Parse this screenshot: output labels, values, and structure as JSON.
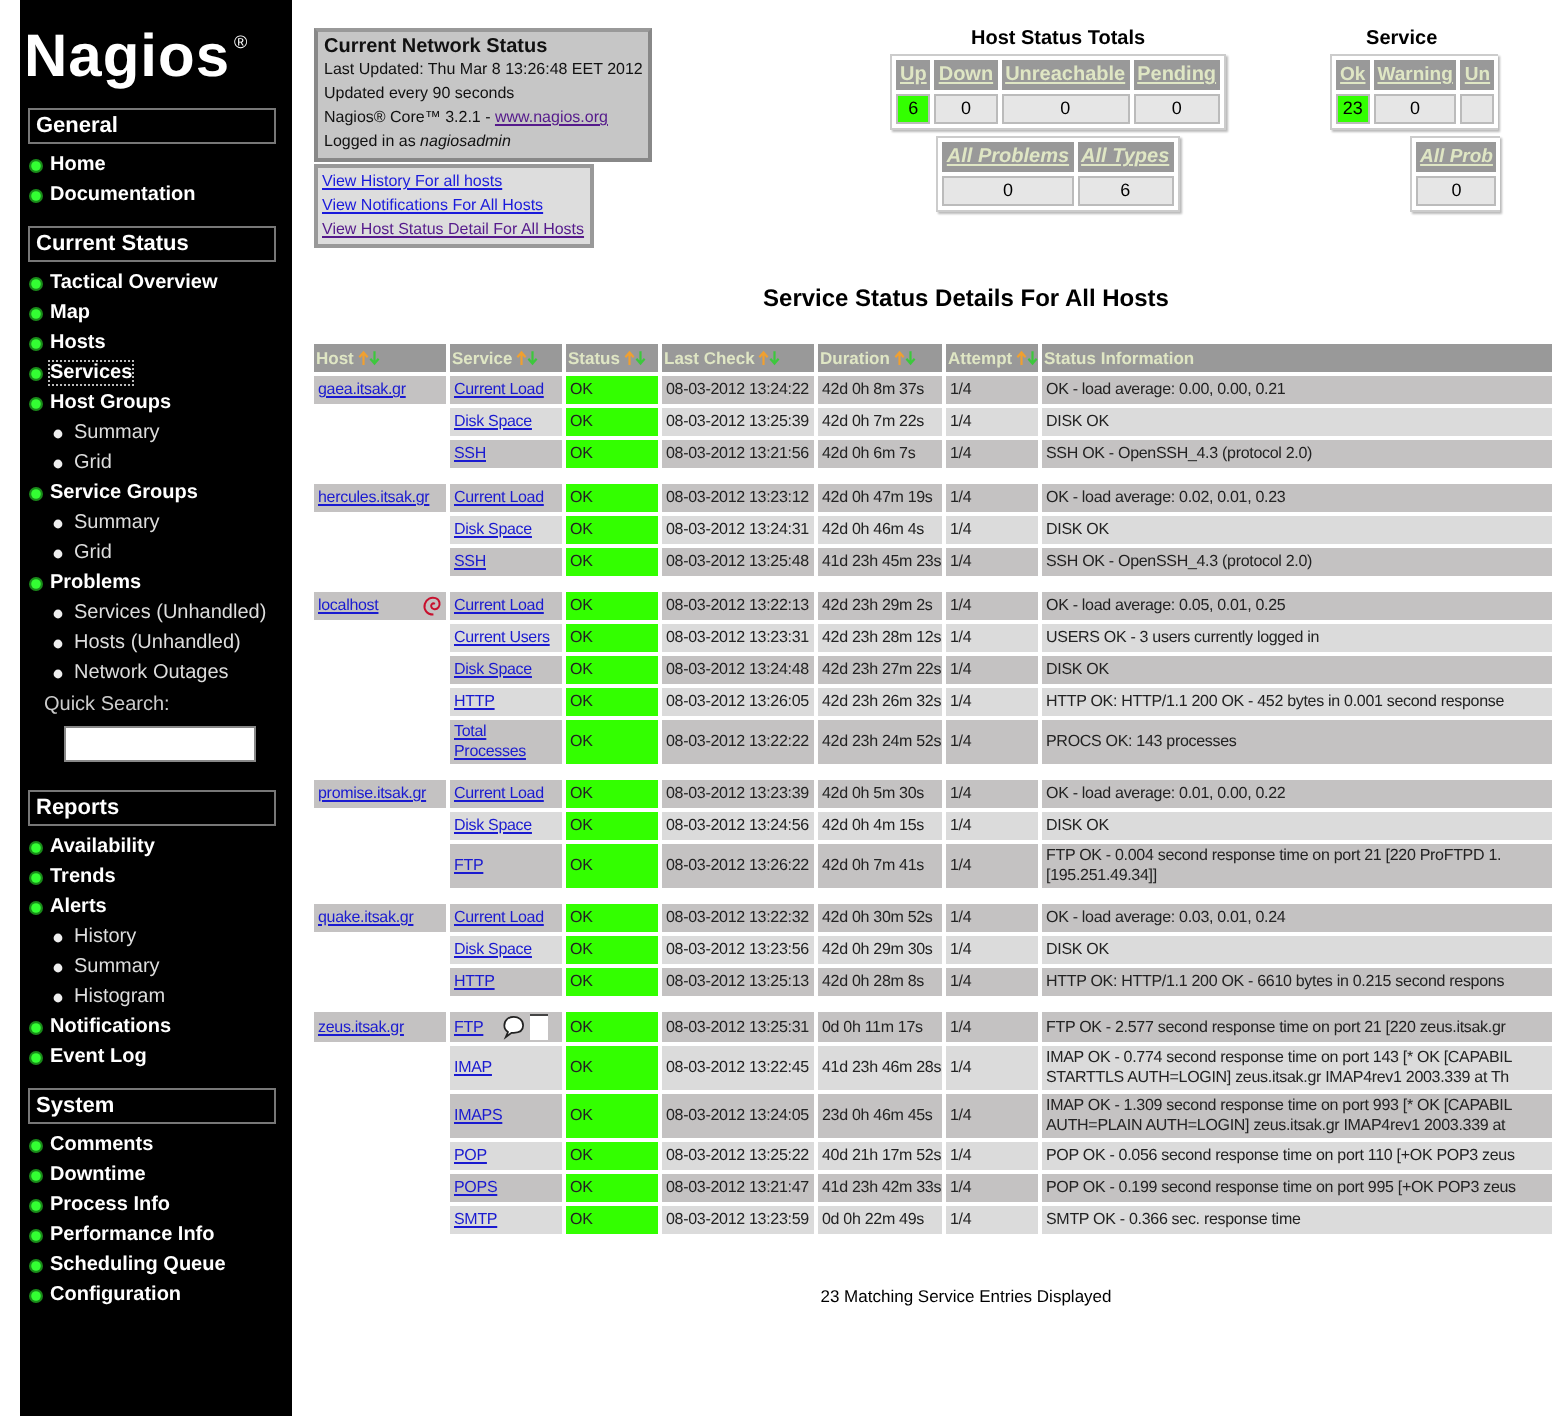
{
  "sidebar": {
    "logo": "Nagios",
    "logo_mark": "®",
    "sections": [
      {
        "title": "General",
        "items": [
          {
            "label": "Home",
            "selected": false
          },
          {
            "label": "Documentation",
            "selected": false
          }
        ]
      },
      {
        "title": "Current Status",
        "items": [
          {
            "label": "Tactical Overview",
            "selected": false
          },
          {
            "label": "Map",
            "selected": false
          },
          {
            "label": "Hosts",
            "selected": false
          },
          {
            "label": "Services",
            "selected": true
          },
          {
            "label": "Host Groups",
            "selected": false,
            "children": [
              {
                "label": "Summary",
                "selected": false
              },
              {
                "label": "Grid",
                "selected": false
              }
            ]
          },
          {
            "label": "Service Groups",
            "selected": false,
            "children": [
              {
                "label": "Summary",
                "selected": false
              },
              {
                "label": "Grid",
                "selected": false
              }
            ]
          },
          {
            "label": "Problems",
            "selected": false,
            "children": [
              {
                "label": "Services (Unhandled)",
                "selected": false
              },
              {
                "label": "Hosts (Unhandled)",
                "selected": false
              },
              {
                "label": "Network Outages",
                "selected": false
              }
            ]
          }
        ],
        "search": {
          "label": "Quick Search:"
        }
      },
      {
        "title": "Reports",
        "items": [
          {
            "label": "Availability",
            "selected": false
          },
          {
            "label": "Trends",
            "selected": false
          },
          {
            "label": "Alerts",
            "selected": false,
            "children": [
              {
                "label": "History",
                "selected": false
              },
              {
                "label": "Summary",
                "selected": false
              },
              {
                "label": "Histogram",
                "selected": false
              }
            ]
          },
          {
            "label": "Notifications",
            "selected": false
          },
          {
            "label": "Event Log",
            "selected": false
          }
        ]
      },
      {
        "title": "System",
        "items": [
          {
            "label": "Comments",
            "selected": false
          },
          {
            "label": "Downtime",
            "selected": false
          },
          {
            "label": "Process Info",
            "selected": false
          },
          {
            "label": "Performance Info",
            "selected": false
          },
          {
            "label": "Scheduling Queue",
            "selected": false
          },
          {
            "label": "Configuration",
            "selected": false
          }
        ]
      }
    ]
  },
  "status_box": {
    "title": "Current Network Status",
    "lines": [
      "Last Updated: Thu Mar 8 13:26:48 EET 2012",
      "Updated every 90 seconds"
    ],
    "version": "Nagios® Core™ 3.2.1 - ",
    "version_link": "www.nagios.org",
    "login": "Logged in as *nagiosadmin*"
  },
  "links": [
    "View History For all hosts",
    "View Notifications For All Hosts",
    "View Host Status Detail For All Hosts"
  ],
  "host_totals": {
    "title": "Host Status Totals",
    "columns": [
      {
        "label": "Up",
        "value": "6",
        "highlighted": true
      },
      {
        "label": "Down",
        "value": "0",
        "highlighted": false
      },
      {
        "label": "Unreachable",
        "value": "0",
        "highlighted": false
      },
      {
        "label": "Pending",
        "value": "0",
        "highlighted": false
      }
    ],
    "problems": [
      {
        "label": "All Problems",
        "value": "0"
      },
      {
        "label": "All Types",
        "value": "6"
      }
    ]
  },
  "service_totals": {
    "title": "Service",
    "columns": [
      {
        "label": "Ok",
        "value": "23",
        "highlighted": true
      },
      {
        "label": "Warning",
        "value": "0",
        "highlighted": false
      },
      {
        "label": "Un",
        "highlighted": false
      }
    ],
    "problems": [
      {
        "label": "All Prob",
        "value": "0"
      }
    ]
  },
  "heading": "Service Status Details For All Hosts",
  "table": {
    "columns": [
      {
        "label": "Host",
        "sortable": true
      },
      {
        "label": "Service",
        "sortable": true
      },
      {
        "label": "Status",
        "sortable": true
      },
      {
        "label": "Last Check",
        "sortable": true
      },
      {
        "label": "Duration",
        "sortable": true
      },
      {
        "label": "Attempt",
        "sortable": true
      },
      {
        "label": "Status Information",
        "sortable": false
      }
    ],
    "hosts": [
      {
        "name": "gaea.itsak.gr",
        "logo": false,
        "services": [
          {
            "name": "Current Load",
            "comment": false,
            "status": "OK",
            "last_check": "08-03-2012 13:24:22",
            "duration": "42d 0h 8m 37s",
            "attempt": "1/4",
            "info": "OK - load average: 0.00, 0.00, 0.21"
          },
          {
            "name": "Disk Space",
            "comment": false,
            "status": "OK",
            "last_check": "08-03-2012 13:25:39",
            "duration": "42d 0h 7m 22s",
            "attempt": "1/4",
            "info": "DISK OK"
          },
          {
            "name": "SSH",
            "comment": false,
            "status": "OK",
            "last_check": "08-03-2012 13:21:56",
            "duration": "42d 0h 6m 7s",
            "attempt": "1/4",
            "info": "SSH OK - OpenSSH_4.3 (protocol 2.0)"
          }
        ]
      },
      {
        "name": "hercules.itsak.gr",
        "logo": false,
        "services": [
          {
            "name": "Current Load",
            "comment": false,
            "status": "OK",
            "last_check": "08-03-2012 13:23:12",
            "duration": "42d 0h 47m 19s",
            "attempt": "1/4",
            "info": "OK - load average: 0.02, 0.01, 0.23"
          },
          {
            "name": "Disk Space",
            "comment": false,
            "status": "OK",
            "last_check": "08-03-2012 13:24:31",
            "duration": "42d 0h 46m 4s",
            "attempt": "1/4",
            "info": "DISK OK"
          },
          {
            "name": "SSH",
            "comment": false,
            "status": "OK",
            "last_check": "08-03-2012 13:25:48",
            "duration": "41d 23h 45m 23s",
            "attempt": "1/4",
            "info": "SSH OK - OpenSSH_4.3 (protocol 2.0)"
          }
        ]
      },
      {
        "name": "localhost",
        "logo": true,
        "services": [
          {
            "name": "Current Load",
            "comment": false,
            "status": "OK",
            "last_check": "08-03-2012 13:22:13",
            "duration": "42d 23h 29m 2s",
            "attempt": "1/4",
            "info": "OK - load average: 0.05, 0.01, 0.25"
          },
          {
            "name": "Current Users",
            "comment": false,
            "status": "OK",
            "last_check": "08-03-2012 13:23:31",
            "duration": "42d 23h 28m 12s",
            "attempt": "1/4",
            "info": "USERS OK - 3 users currently logged in"
          },
          {
            "name": "Disk Space",
            "comment": false,
            "status": "OK",
            "last_check": "08-03-2012 13:24:48",
            "duration": "42d 23h 27m 22s",
            "attempt": "1/4",
            "info": "DISK OK"
          },
          {
            "name": "HTTP",
            "comment": false,
            "status": "OK",
            "last_check": "08-03-2012 13:26:05",
            "duration": "42d 23h 26m 32s",
            "attempt": "1/4",
            "info": "HTTP OK: HTTP/1.1 200 OK - 452 bytes in 0.001 second response"
          },
          {
            "name": "Total Processes",
            "comment": false,
            "status": "OK",
            "last_check": "08-03-2012 13:22:22",
            "duration": "42d 23h 24m 52s",
            "attempt": "1/4",
            "info": "PROCS OK: 143 processes"
          }
        ]
      },
      {
        "name": "promise.itsak.gr",
        "logo": false,
        "services": [
          {
            "name": "Current Load",
            "comment": false,
            "status": "OK",
            "last_check": "08-03-2012 13:23:39",
            "duration": "42d 0h 5m 30s",
            "attempt": "1/4",
            "info": "OK - load average: 0.01, 0.00, 0.22"
          },
          {
            "name": "Disk Space",
            "comment": false,
            "status": "OK",
            "last_check": "08-03-2012 13:24:56",
            "duration": "42d 0h 4m 15s",
            "attempt": "1/4",
            "info": "DISK OK"
          },
          {
            "name": "FTP",
            "comment": false,
            "status": "OK",
            "last_check": "08-03-2012 13:26:22",
            "duration": "42d 0h 7m 41s",
            "attempt": "1/4",
            "info": "FTP OK - 0.004 second response time on port 21 [220 ProFTPD 1. [195.251.49.34]]"
          }
        ]
      },
      {
        "name": "quake.itsak.gr",
        "logo": false,
        "services": [
          {
            "name": "Current Load",
            "comment": false,
            "status": "OK",
            "last_check": "08-03-2012 13:22:32",
            "duration": "42d 0h 30m 52s",
            "attempt": "1/4",
            "info": "OK - load average: 0.03, 0.01, 0.24"
          },
          {
            "name": "Disk Space",
            "comment": false,
            "status": "OK",
            "last_check": "08-03-2012 13:23:56",
            "duration": "42d 0h 29m 30s",
            "attempt": "1/4",
            "info": "DISK OK"
          },
          {
            "name": "HTTP",
            "comment": false,
            "status": "OK",
            "last_check": "08-03-2012 13:25:13",
            "duration": "42d 0h 28m 8s",
            "attempt": "1/4",
            "info": "HTTP OK: HTTP/1.1 200 OK - 6610 bytes in 0.215 second respons"
          }
        ]
      },
      {
        "name": "zeus.itsak.gr",
        "logo": false,
        "services": [
          {
            "name": "FTP",
            "comment": true,
            "status": "OK",
            "last_check": "08-03-2012 13:25:31",
            "duration": "0d 0h 11m 17s",
            "attempt": "1/4",
            "info": "FTP OK - 2.577 second response time on port 21 [220 zeus.itsak.gr"
          },
          {
            "name": "IMAP",
            "comment": false,
            "status": "OK",
            "last_check": "08-03-2012 13:22:45",
            "duration": "41d 23h 46m 28s",
            "attempt": "1/4",
            "info": "IMAP OK - 0.774 second response time on port 143 [* OK [CAPABIL STARTTLS AUTH=LOGIN] zeus.itsak.gr IMAP4rev1 2003.339 at Th"
          },
          {
            "name": "IMAPS",
            "comment": false,
            "status": "OK",
            "last_check": "08-03-2012 13:24:05",
            "duration": "23d 0h 46m 45s",
            "attempt": "1/4",
            "info": "IMAP OK - 1.309 second response time on port 993 [* OK [CAPABIL AUTH=PLAIN AUTH=LOGIN] zeus.itsak.gr IMAP4rev1 2003.339 at"
          },
          {
            "name": "POP",
            "comment": false,
            "status": "OK",
            "last_check": "08-03-2012 13:25:22",
            "duration": "40d 21h 17m 52s",
            "attempt": "1/4",
            "info": "POP OK - 0.056 second response time on port 110 [+OK POP3 zeus"
          },
          {
            "name": "POPS",
            "comment": false,
            "status": "OK",
            "last_check": "08-03-2012 13:21:47",
            "duration": "41d 23h 42m 33s",
            "attempt": "1/4",
            "info": "POP OK - 0.199 second response time on port 995 [+OK POP3 zeus"
          },
          {
            "name": "SMTP",
            "comment": false,
            "status": "OK",
            "last_check": "08-03-2012 13:23:59",
            "duration": "0d 0h 22m 49s",
            "attempt": "1/4",
            "info": "SMTP OK - 0.366 sec. response time"
          }
        ]
      }
    ]
  },
  "footer": "23 Matching Service Entries Displayed"
}
